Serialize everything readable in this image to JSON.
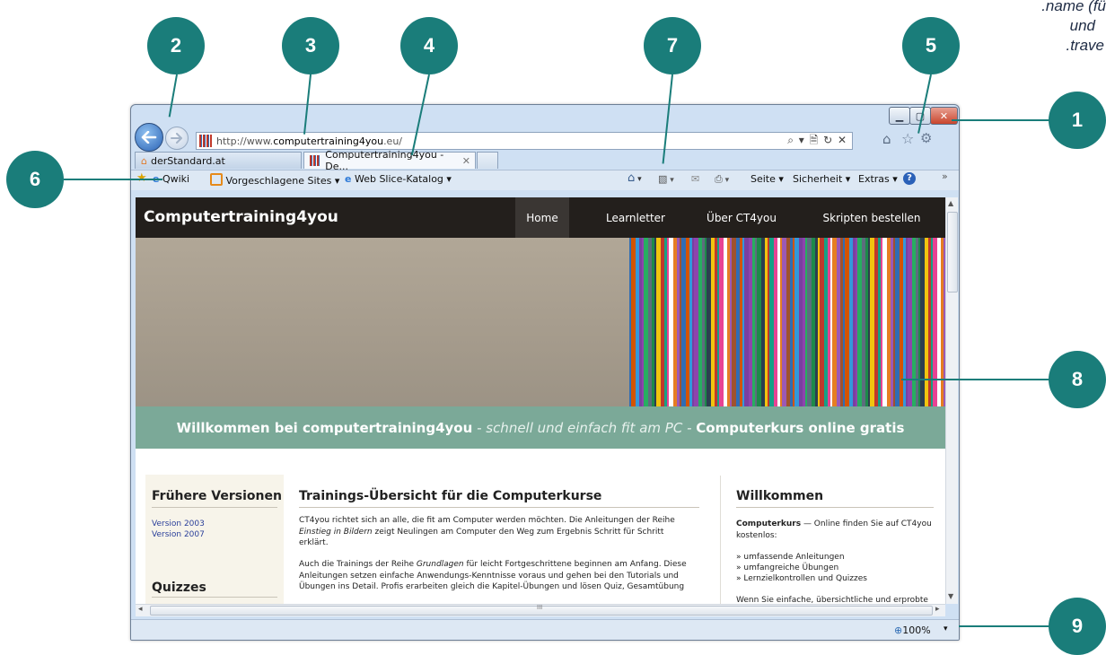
{
  "callouts": [
    "1",
    "2",
    "3",
    "4",
    "5",
    "6",
    "7",
    "8",
    "9"
  ],
  "cutoff_caption": [
    ".name (fü",
    "und",
    ".trave"
  ],
  "browser": {
    "address_prefix": "http://www.",
    "address_domain": "computertraining4you",
    "address_suffix": ".eu/",
    "addr_icons": "⌕ ▾ 🗎 ↻ ✕",
    "tabs": [
      {
        "label": "derStandard.at"
      },
      {
        "label": "Computertraining4you - De...",
        "close": "✕"
      }
    ],
    "favorites_bar": {
      "qwiki": "Qwiki",
      "suggested_sites": "Vorgeschlagene Sites ▾",
      "web_slice": "Web Slice-Katalog ▾"
    },
    "command_bar": {
      "page": "Seite ▾",
      "security": "Sicherheit ▾",
      "extras": "Extras ▾",
      "overflow": "»"
    },
    "status": {
      "zoom": "100%",
      "zoom_arrow": "▾"
    },
    "hscroll_grip": "III"
  },
  "site": {
    "brand": "Computertraining4you",
    "nav": [
      "Home",
      "Learnletter",
      "Über CT4you",
      "Skripten bestellen"
    ],
    "banner": {
      "part1": "Willkommen bei computertraining4you",
      "sep1": " - ",
      "part2": "schnell und einfach fit am PC",
      "sep2": " - ",
      "part3": "Computerkurs online gratis"
    },
    "left": {
      "heading": "Frühere Versionen",
      "links": [
        "Version 2003",
        "Version 2007"
      ],
      "quiz_heading": "Quizzes"
    },
    "main": {
      "heading": "Trainings-Übersicht für die Computerkurse",
      "p1a": "CT4you richtet sich an alle, die fit am Computer werden möchten. Die Anleitungen der Reihe",
      "p1b": "Einstieg in Bildern",
      "p1c": "zeigt Neulingen am Computer den Weg zum Ergebnis Schritt für Schritt erklärt.",
      "p2a": "Auch die Trainings der Reihe",
      "p2b": "Grundlagen",
      "p2c": "für leicht Fortgeschrittene beginnen am Anfang. Diese Anleitungen setzen einfache Anwendungs-Kenntnisse voraus und gehen bei den Tutorials und Übungen ins Detail. Profis erarbeiten gleich die Kapitel-Übungen und lösen Quiz, Gesamtübung"
    },
    "right": {
      "heading": "Willkommen",
      "intro_bold": "Computerkurs",
      "intro_rest": "— Online finden Sie auf CT4you kostenlos:",
      "bullets": [
        "» umfassende Anleitungen",
        "» umfangreiche Übungen",
        "» Lernzielkontrollen und Quizzes"
      ],
      "tail": "Wenn Sie einfache, übersichtliche und erprobte"
    }
  },
  "colors": {
    "callout": "#1a7d7a",
    "nav_bg": "#231f1c",
    "banner_bg": "#7ba998"
  }
}
